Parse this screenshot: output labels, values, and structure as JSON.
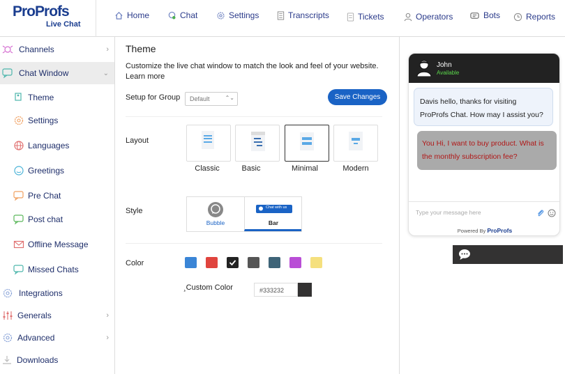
{
  "logo": {
    "brand_pro": "Pro",
    "brand_profs": "Profs",
    "product": "Live Chat"
  },
  "nav": {
    "items": [
      {
        "label": "Home",
        "icon": "home-icon"
      },
      {
        "label": "Chat",
        "icon": "chat-icon"
      },
      {
        "label": "Settings",
        "icon": "gear-icon"
      },
      {
        "label": "Transcripts",
        "icon": "transcript-icon"
      },
      {
        "label": "Tickets",
        "icon": "ticket-icon"
      },
      {
        "label": "Operators",
        "icon": "user-icon"
      },
      {
        "label": "Bots",
        "icon": "bot-icon"
      },
      {
        "label": "Reports",
        "icon": "clock-icon"
      }
    ]
  },
  "sidebar": {
    "items": [
      {
        "label": "Channels",
        "icon": "channels-icon"
      },
      {
        "label": "Chat Window",
        "icon": "chat-window-icon"
      },
      {
        "label": "Theme",
        "icon": "theme-icon"
      },
      {
        "label": "Settings",
        "icon": "gear-icon"
      },
      {
        "label": "Languages",
        "icon": "globe-icon"
      },
      {
        "label": "Greetings",
        "icon": "smile-icon"
      },
      {
        "label": "Pre Chat",
        "icon": "pre-chat-icon"
      },
      {
        "label": "Post chat",
        "icon": "post-chat-icon"
      },
      {
        "label": "Offline Message",
        "icon": "mail-icon"
      },
      {
        "label": "Missed Chats",
        "icon": "missed-chat-icon"
      },
      {
        "label": "Integrations",
        "icon": "integrations-icon"
      },
      {
        "label": "Generals",
        "icon": "sliders-icon"
      },
      {
        "label": "Advanced",
        "icon": "gear-icon"
      },
      {
        "label": "Downloads",
        "icon": "download-icon"
      }
    ]
  },
  "main": {
    "title": "Theme",
    "description": "Customize the live chat window to match the look and feel of your website. Learn more",
    "group_label": "Setup for Group",
    "group_value": "Default",
    "save_label": "Save Changes",
    "layout_label": "Layout",
    "layouts": [
      "Classic",
      "Basic",
      "Minimal",
      "Modern"
    ],
    "selected_layout": "Minimal",
    "style_label": "Style",
    "styles": {
      "bubble": "Bubble",
      "bar": "Bar",
      "bar_chip": "Chat with us"
    },
    "selected_style": "Bar",
    "color_label": "Color",
    "colors": [
      "#3a85d6",
      "#e0443e",
      "#222222",
      "#555555",
      "#3e6478",
      "#b94ed6",
      "#f5e07e"
    ],
    "selected_color": "#222222",
    "custom_color_label": "Custom Color",
    "custom_color_value": "#333232"
  },
  "preview": {
    "agent_name": "John",
    "agent_status": "Available",
    "message_agent": "Davis hello, thanks for visiting ProProfs Chat. How may I assist you?",
    "message_user": "You Hi, I want to buy product. What is the monthly subscription fee?",
    "input_placeholder": "Type your message here",
    "powered_by": "Powered By",
    "powered_brand": "ProProfs"
  }
}
